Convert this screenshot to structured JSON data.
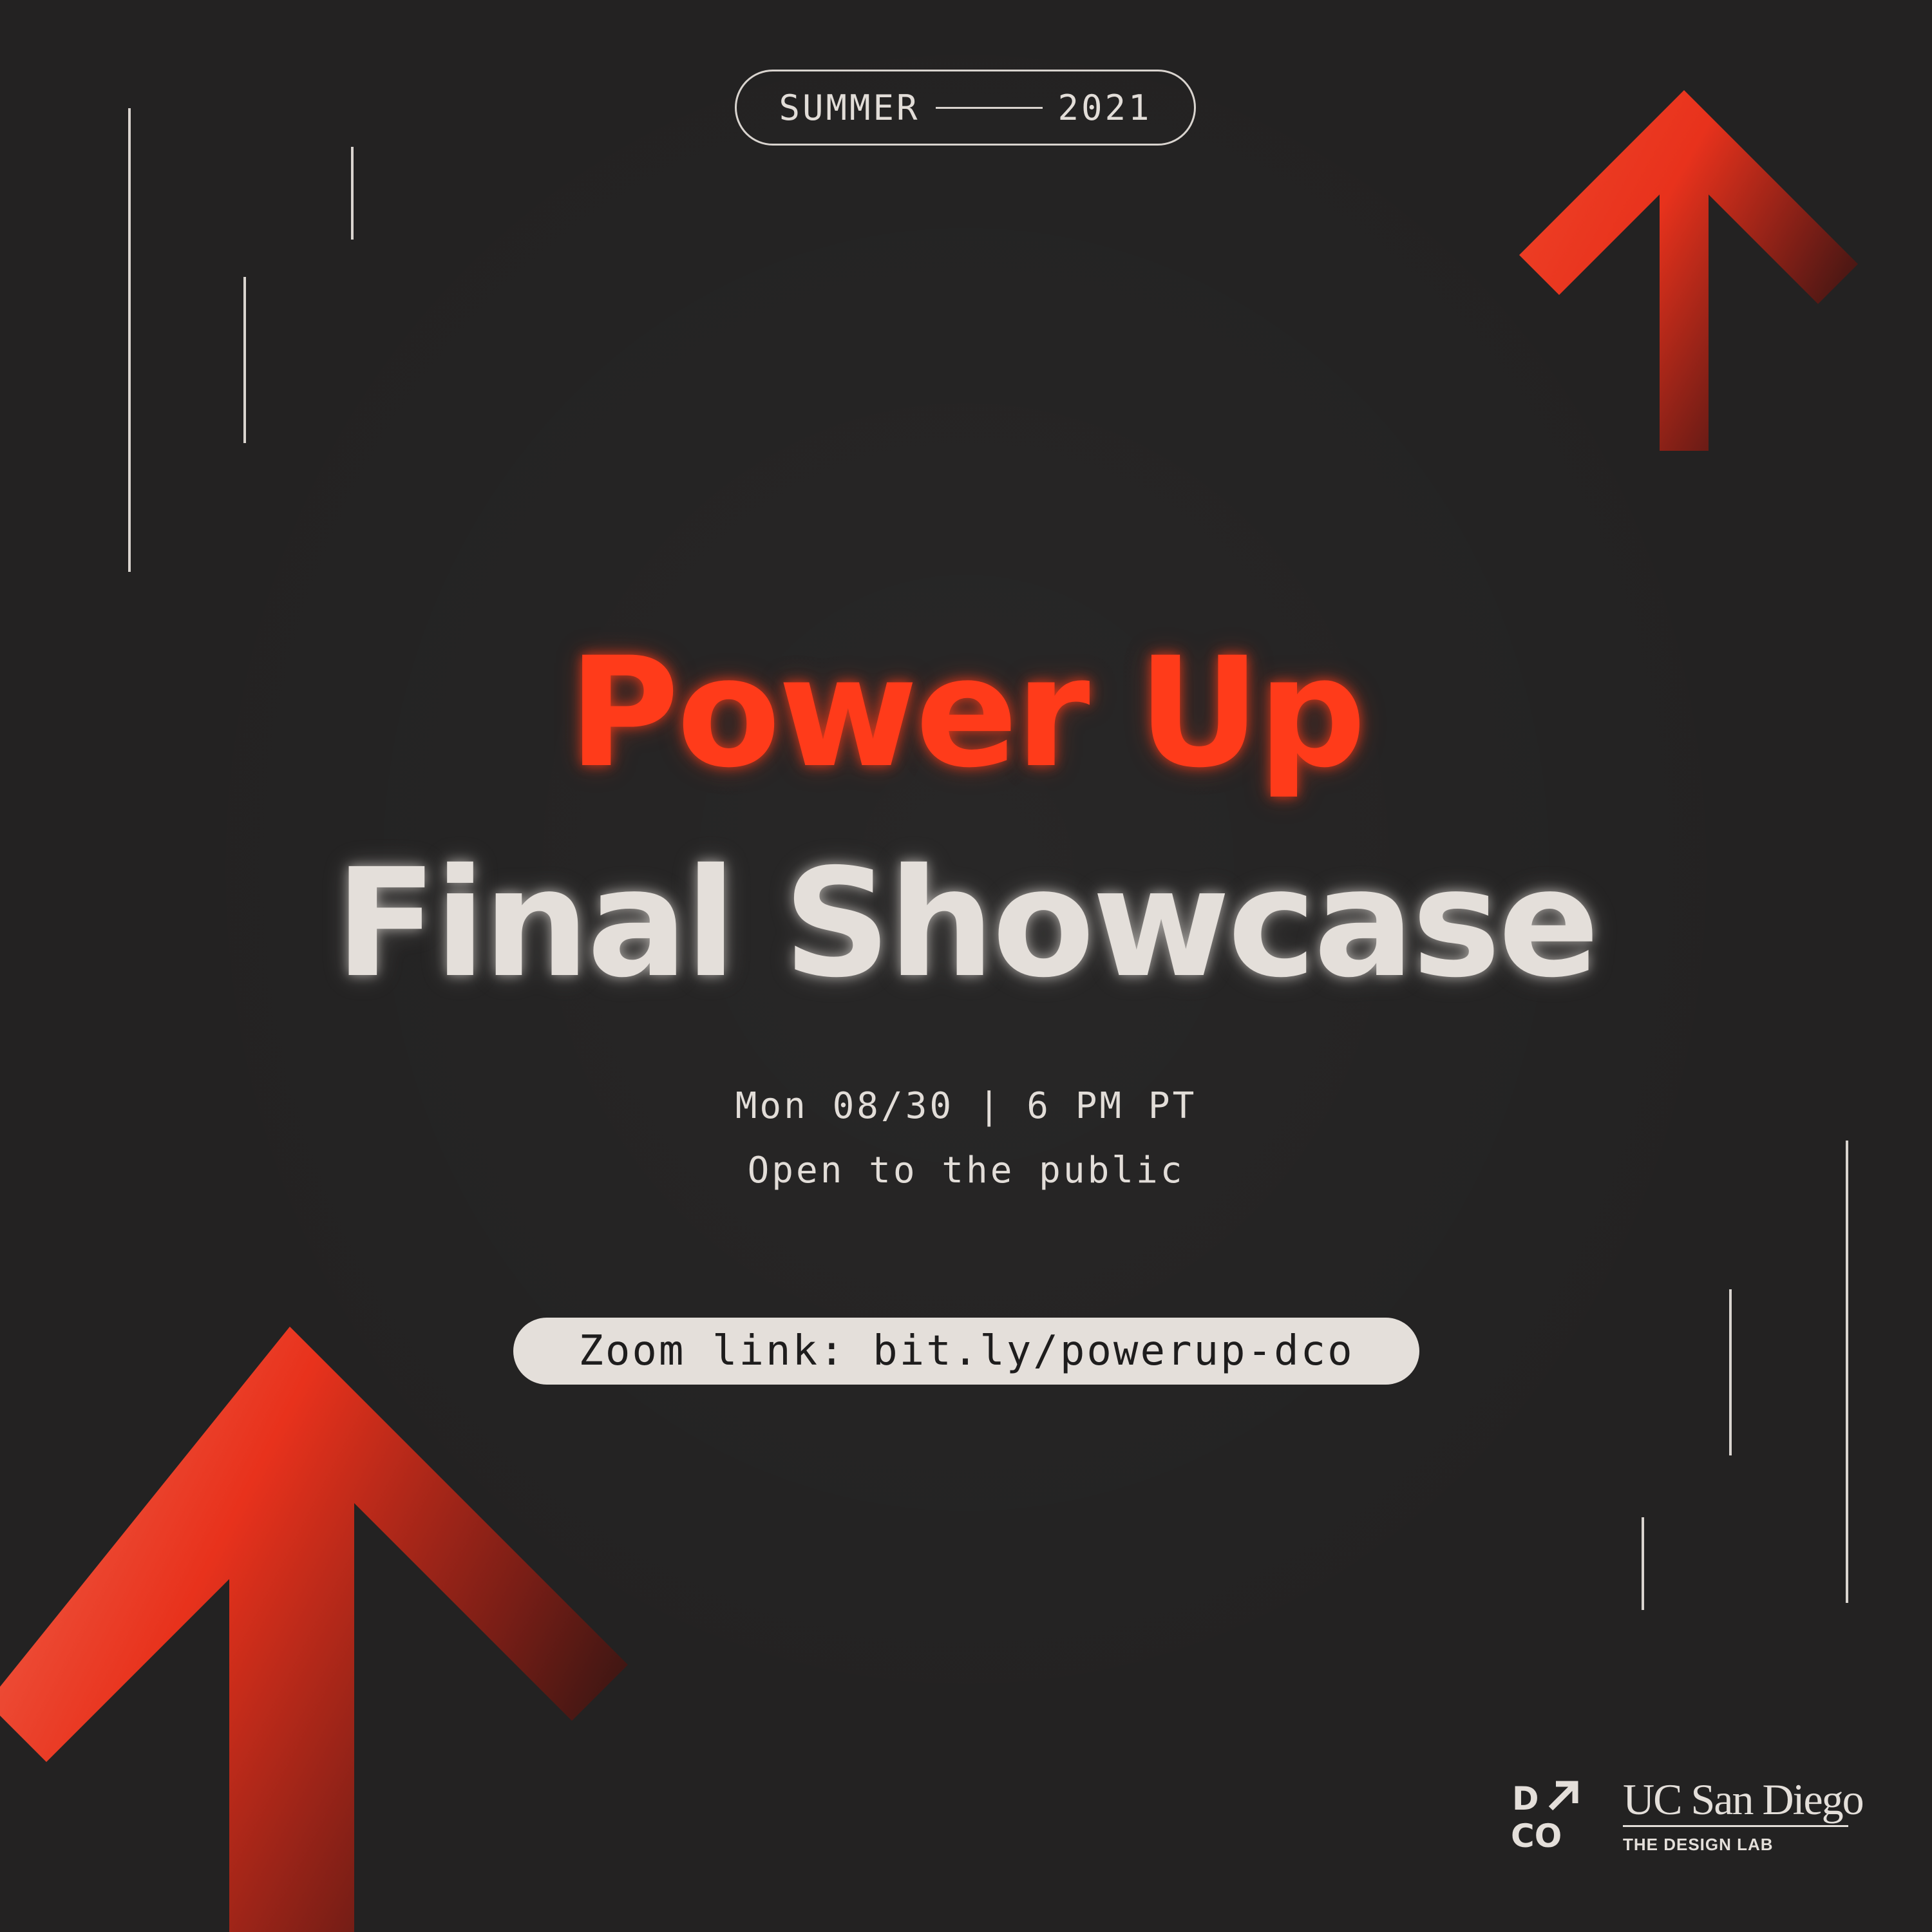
{
  "season": {
    "label": "SUMMER",
    "year": "2021"
  },
  "title": {
    "line1": "Power Up",
    "line2": "Final Showcase"
  },
  "event": {
    "datetime": "Mon 08/30 | 6 PM PT",
    "access": "Open to the public"
  },
  "zoom": {
    "text": "Zoom link: bit.ly/powerup-dco"
  },
  "logos": {
    "dco": {
      "top": "D",
      "bottom": "CO"
    },
    "ucsd": {
      "name": "UC San Diego",
      "subtitle": "THE DESIGN LAB"
    }
  },
  "colors": {
    "accent": "#ff3b1a",
    "background": "#232222",
    "light": "#e4dfda"
  },
  "icons": [
    "arrow-up-icon",
    "arrow-up-icon"
  ]
}
